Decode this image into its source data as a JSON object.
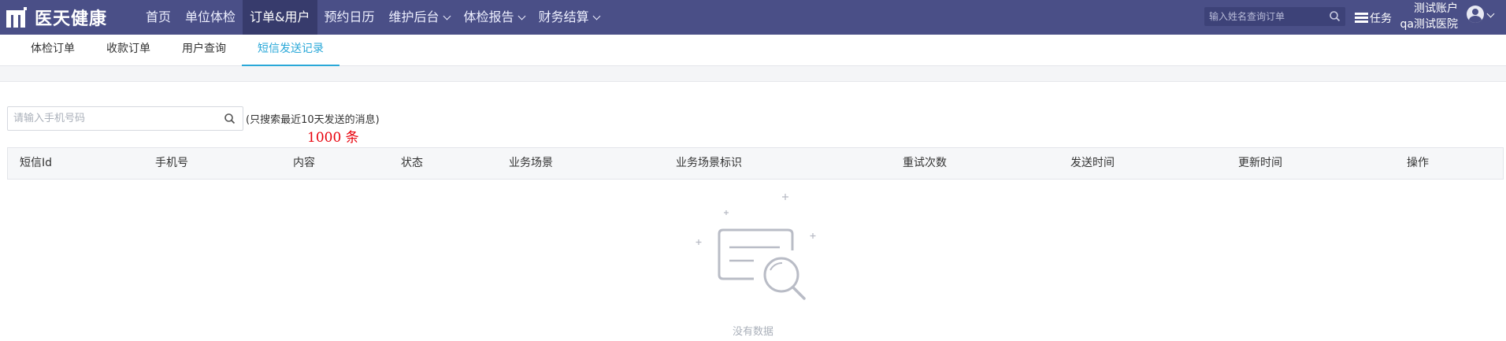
{
  "app": {
    "logo_text": "医天健康",
    "logo_icon": "m-logo-icon"
  },
  "nav": {
    "items": [
      {
        "label": "首页",
        "has_dropdown": false,
        "active": false
      },
      {
        "label": "单位体检",
        "has_dropdown": false,
        "active": false
      },
      {
        "label": "订单&用户",
        "has_dropdown": false,
        "active": true
      },
      {
        "label": "预约日历",
        "has_dropdown": false,
        "active": false
      },
      {
        "label": "维护后台",
        "has_dropdown": true,
        "active": false
      },
      {
        "label": "体检报告",
        "has_dropdown": true,
        "active": false
      },
      {
        "label": "财务结算",
        "has_dropdown": true,
        "active": false
      }
    ]
  },
  "header": {
    "search_placeholder": "输入姓名查询订单",
    "task_label": "任务",
    "account_name": "测试账户",
    "hospital_name": "qa测试医院"
  },
  "subtabs": {
    "items": [
      {
        "label": "体检订单",
        "active": false
      },
      {
        "label": "收款订单",
        "active": false
      },
      {
        "label": "用户查询",
        "active": false
      },
      {
        "label": "短信发送记录",
        "active": true
      }
    ]
  },
  "filter": {
    "phone_placeholder": "请输入手机号码",
    "hint": "(只搜索最近10天发送的消息)",
    "count_label": "1000 条"
  },
  "table": {
    "columns": [
      "短信Id",
      "手机号",
      "内容",
      "状态",
      "业务场景",
      "业务场景标识",
      "重试次数",
      "发送时间",
      "更新时间",
      "操作"
    ],
    "rows": [],
    "empty_text": "没有数据"
  },
  "colors": {
    "topbar": "#4a4f87",
    "active_tab": "#2aa8d8",
    "count": "#e8000b"
  }
}
